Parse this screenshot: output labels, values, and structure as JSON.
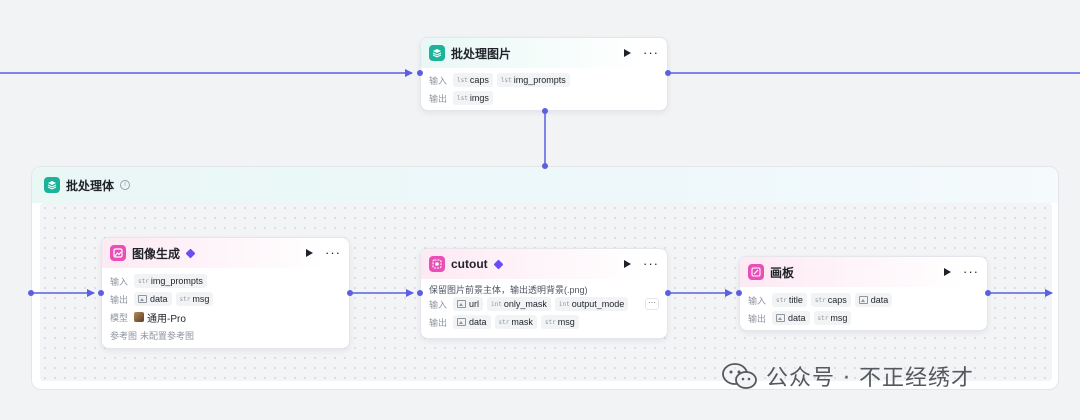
{
  "group": {
    "title": "批处理体"
  },
  "nodes": {
    "batch": {
      "title": "批处理图片",
      "inputs_label": "输入",
      "outputs_label": "输出",
      "inputs": [
        {
          "type_icon": "list-icon",
          "name": "caps"
        },
        {
          "type_icon": "list-icon",
          "name": "img_prompts"
        }
      ],
      "outputs": [
        {
          "type_icon": "list-icon",
          "name": "imgs"
        }
      ]
    },
    "imagegen": {
      "title": "图像生成",
      "inputs_label": "输入",
      "outputs_label": "输出",
      "model_label": "模型",
      "ref_label": "参考图",
      "inputs": [
        {
          "type_icon": "str-icon",
          "name": "img_prompts"
        }
      ],
      "outputs": [
        {
          "type_icon": "image-icon",
          "name": "data"
        },
        {
          "type_icon": "str-icon",
          "name": "msg"
        }
      ],
      "model_value": "通用-Pro",
      "ref_value": "未配置参考图"
    },
    "cutout": {
      "title": "cutout",
      "description": "保留图片前景主体，输出透明背景(.png)",
      "inputs_label": "输入",
      "outputs_label": "输出",
      "inputs": [
        {
          "type_icon": "image-icon",
          "name": "url"
        },
        {
          "type_icon": "int-icon",
          "name": "only_mask"
        },
        {
          "type_icon": "int-icon",
          "name": "output_mode"
        }
      ],
      "overflow": "···",
      "outputs": [
        {
          "type_icon": "image-icon",
          "name": "data"
        },
        {
          "type_icon": "str-icon",
          "name": "mask"
        },
        {
          "type_icon": "str-icon",
          "name": "msg"
        }
      ]
    },
    "canvas": {
      "title": "画板",
      "inputs_label": "输入",
      "outputs_label": "输出",
      "inputs": [
        {
          "type_icon": "str-icon",
          "name": "title"
        },
        {
          "type_icon": "str-icon",
          "name": "caps"
        },
        {
          "type_icon": "image-icon",
          "name": "data"
        }
      ],
      "outputs": [
        {
          "type_icon": "image-icon",
          "name": "data"
        },
        {
          "type_icon": "str-icon",
          "name": "msg"
        }
      ]
    }
  },
  "type_glyphs": {
    "str": "str",
    "list": "lst",
    "int": "int"
  },
  "watermark": "公众号 · 不正经绣才",
  "colors": {
    "edge": "#5b5fe0",
    "teal_icon": "#1bb39a",
    "pink_icon": "#e94fb6",
    "premium_badge": "#6b4cf6"
  }
}
